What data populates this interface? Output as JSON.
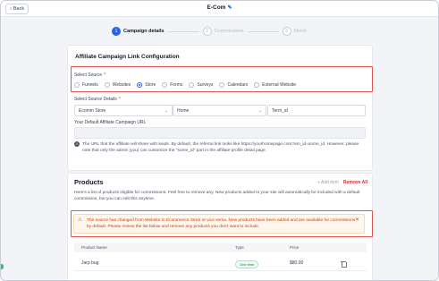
{
  "topbar": {
    "back_label": "Back",
    "title": "E-Com",
    "edit_icon": "pencil-icon"
  },
  "stepper": [
    {
      "num": "1",
      "label": "Campaign details",
      "state": "active"
    },
    {
      "num": "2",
      "label": "Commissions",
      "state": "inactive"
    },
    {
      "num": "3",
      "label": "Finish",
      "state": "inactive"
    }
  ],
  "config": {
    "title": "Affiliate Campaign Link Configuration",
    "select_source_label": "Select Source",
    "required_mark": "*",
    "sources": [
      "Funnels",
      "Websites",
      "Store",
      "Forms",
      "Surveys",
      "Calendars",
      "External Website"
    ],
    "selected_source": "Store",
    "source_details_label": "Select Source Details",
    "required_mark2": "*",
    "detail_1": "Ecomm Store",
    "detail_2": "Home",
    "detail_3": "Term_id",
    "default_link_label": "Your Default Affiliate Campaign URL",
    "info_text": "The URL that the affiliate will share with leads. By default, the referral link looks like https://yourhomepage.com?am_id=some_id. However, please note that only the admin (you) can customize the \"some_id\" part in the affiliate profile detail page."
  },
  "products": {
    "title": "Products",
    "add_item": "+ Add item",
    "remove_all": "Remove All",
    "description": "Here's a list of products eligible for commissions. Feel free to remove any. New products added to your site will automatically be included with a default commission, but you can edit this anytime.",
    "warning": "The source has changed from Website to Ecommerce Store or vice versa. New products have been added and are available for commissions by default. Please review the list below and remove any products you don't want to include.",
    "columns": [
      "Product Name",
      "Type",
      "Price"
    ],
    "rows": [
      {
        "name": "Jarp bug",
        "type": "One time",
        "price": "$80.00"
      }
    ]
  },
  "colors": {
    "accent": "#2563eb",
    "highlight": "#e05656",
    "warning_bg": "#fff7ed",
    "warning_text": "#c2410c"
  }
}
